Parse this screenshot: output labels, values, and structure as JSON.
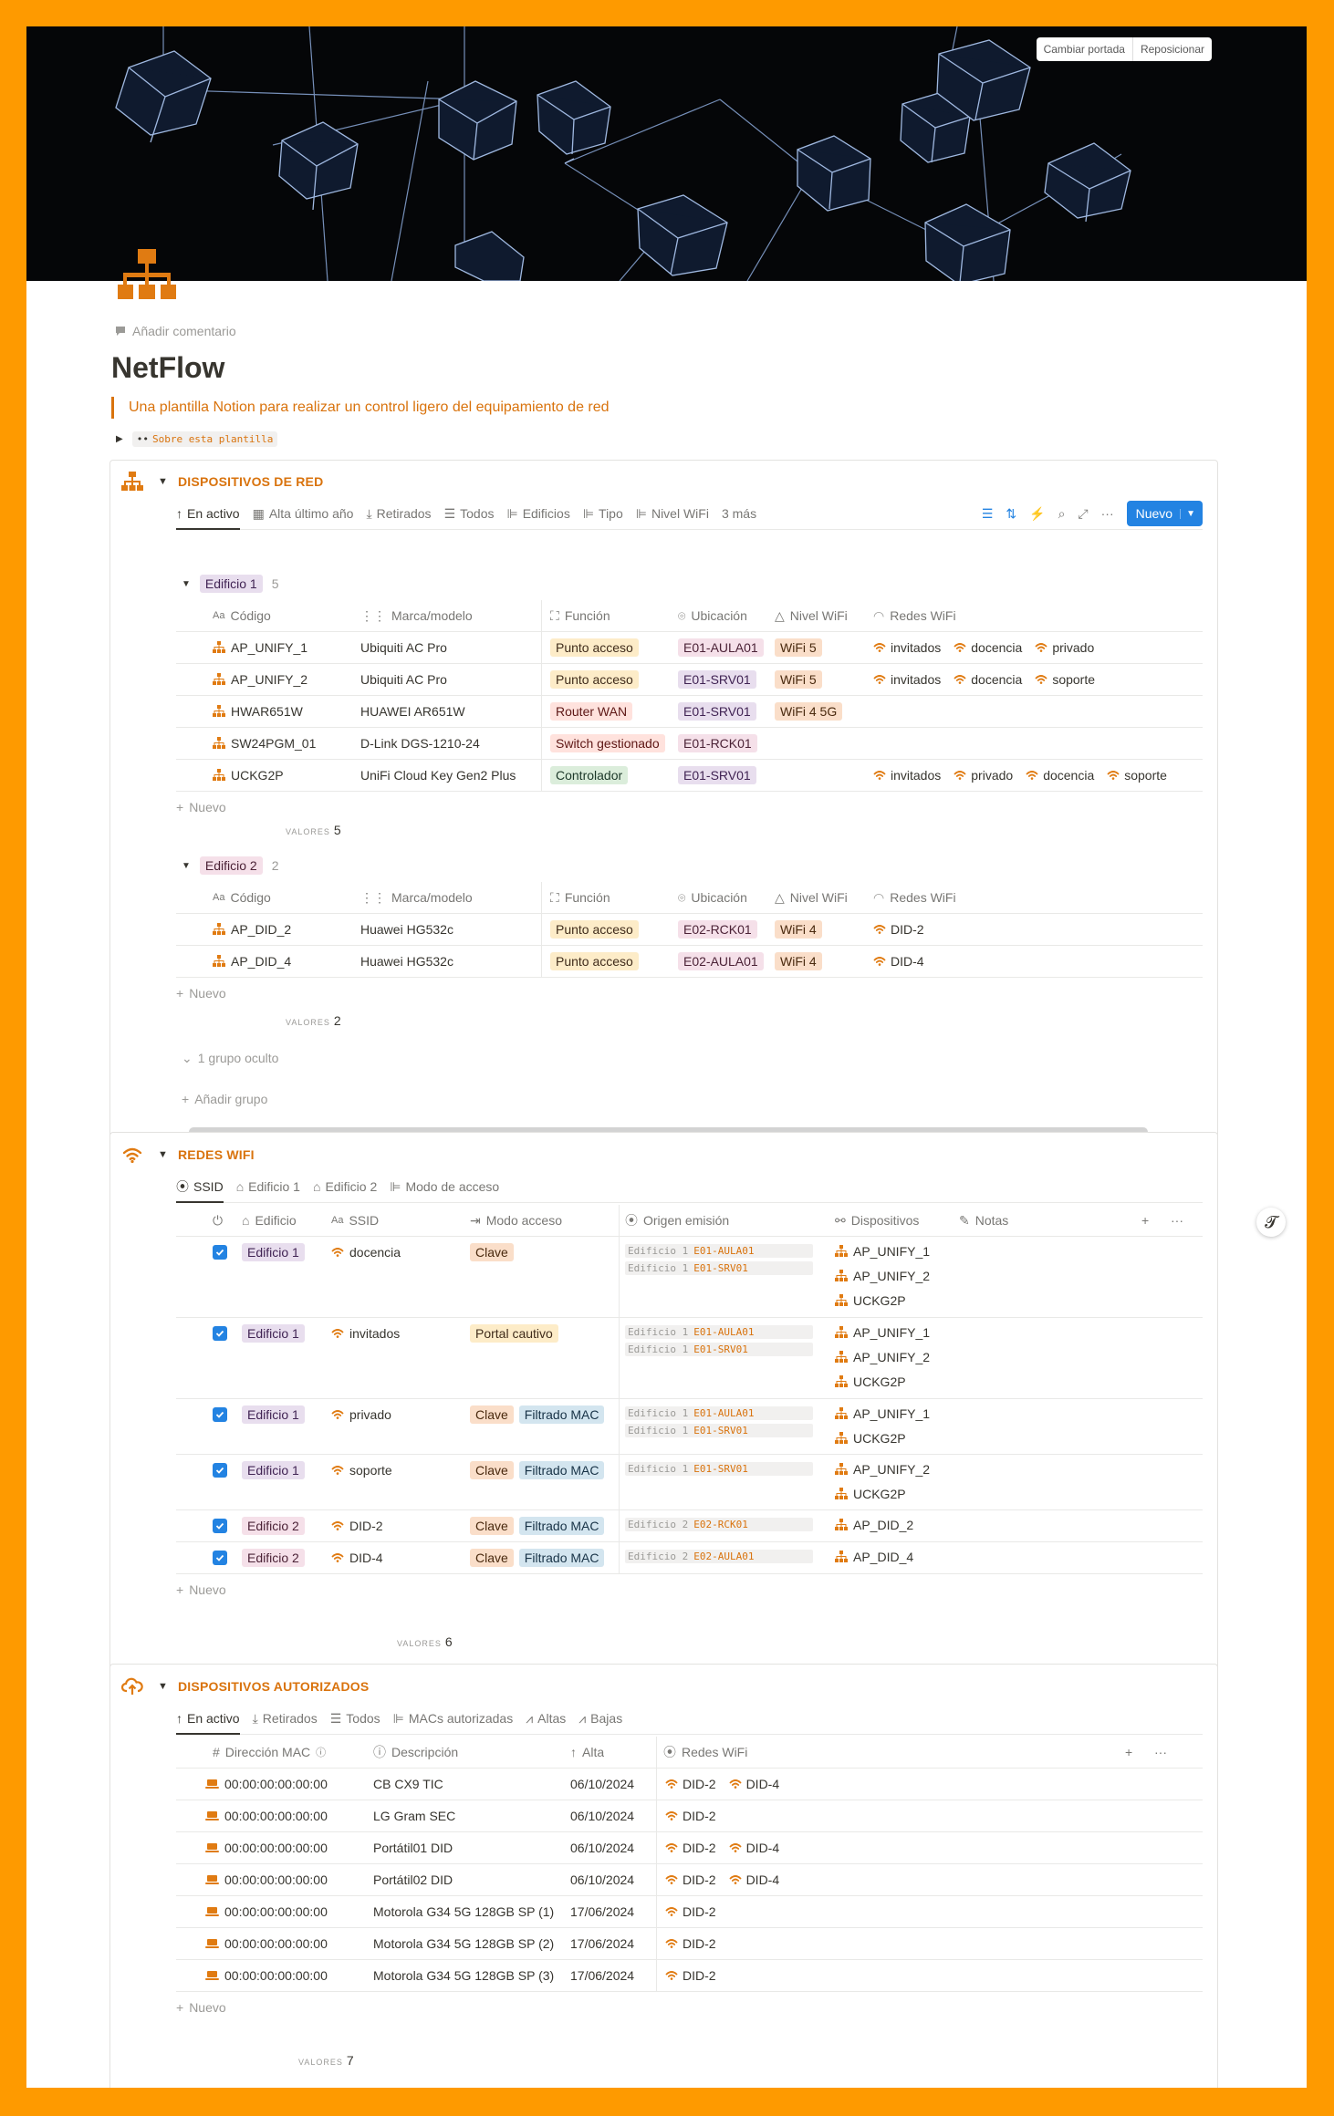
{
  "cover": {
    "change_label": "Cambiar portada",
    "reposition_label": "Reposicionar"
  },
  "page": {
    "icon": "network-hierarchy-icon",
    "add_comment": "Añadir comentario",
    "title": "NetFlow",
    "quote": "Una plantilla Notion para realizar un control ligero del equipamiento de red",
    "toggle_label": "Sobre esta plantilla",
    "toggle_prefix": "••"
  },
  "colors": {
    "accent": "#d9730d",
    "blue": "#2383e2",
    "background": "#fe9a00"
  },
  "devices": {
    "title": "DISPOSITIVOS DE RED",
    "views": [
      {
        "label": "En activo",
        "icon": "arrow-up-icon"
      },
      {
        "label": "Alta último año",
        "icon": "calendar-icon"
      },
      {
        "label": "Retirados",
        "icon": "download-icon"
      },
      {
        "label": "Todos",
        "icon": "list-icon"
      },
      {
        "label": "Edificios",
        "icon": "board-icon"
      },
      {
        "label": "Tipo",
        "icon": "board-icon"
      },
      {
        "label": "Nivel WiFi",
        "icon": "board-icon"
      }
    ],
    "more_views": "3 más",
    "new_button": "Nuevo",
    "columns": [
      "Código",
      "Marca/modelo",
      "Función",
      "Ubicación",
      "Nivel WiFi",
      "Redes WiFi"
    ],
    "groups": [
      {
        "name": "Edificio 1",
        "count": "5",
        "rows": [
          {
            "code": "AP_UNIFY_1",
            "model": "Ubiquiti AC Pro",
            "function": "Punto acceso",
            "location": "E01-AULA01",
            "wifi_level": "WiFi 5",
            "networks": [
              "invitados",
              "docencia",
              "privado"
            ]
          },
          {
            "code": "AP_UNIFY_2",
            "model": "Ubiquiti AC Pro",
            "function": "Punto acceso",
            "location": "E01-SRV01",
            "wifi_level": "WiFi 5",
            "networks": [
              "invitados",
              "docencia",
              "soporte"
            ]
          },
          {
            "code": "HWAR651W",
            "model": "HUAWEI AR651W",
            "function": "Router WAN",
            "location": "E01-SRV01",
            "wifi_level": "WiFi 4 5G",
            "networks": []
          },
          {
            "code": "SW24PGM_01",
            "model": "D-Link DGS-1210-24",
            "function": "Switch gestionado",
            "location": "E01-RCK01",
            "wifi_level": "",
            "networks": []
          },
          {
            "code": "UCKG2P",
            "model": "UniFi Cloud Key Gen2 Plus",
            "function": "Controlador",
            "location": "E01-SRV01",
            "wifi_level": "",
            "networks": [
              "invitados",
              "privado",
              "docencia",
              "soporte"
            ]
          }
        ],
        "values_label": "VALORES",
        "values_count": "5"
      },
      {
        "name": "Edificio 2",
        "count": "2",
        "rows": [
          {
            "code": "AP_DID_2",
            "model": "Huawei HG532c",
            "function": "Punto acceso",
            "location": "E02-RCK01",
            "wifi_level": "WiFi 4",
            "networks": [
              "DID-2"
            ]
          },
          {
            "code": "AP_DID_4",
            "model": "Huawei HG532c",
            "function": "Punto acceso",
            "location": "E02-AULA01",
            "wifi_level": "WiFi 4",
            "networks": [
              "DID-4"
            ]
          }
        ],
        "values_label": "VALORES",
        "values_count": "2"
      }
    ],
    "new_row": "Nuevo",
    "hidden_group": "1 grupo oculto",
    "add_group": "Añadir grupo"
  },
  "wifi": {
    "title": "REDES WIFI",
    "views": [
      {
        "label": "SSID",
        "icon": "broadcast-icon"
      },
      {
        "label": "Edificio 1",
        "icon": "building-icon"
      },
      {
        "label": "Edificio 2",
        "icon": "building-icon"
      },
      {
        "label": "Modo de acceso",
        "icon": "board-icon"
      }
    ],
    "columns": [
      "Edificio",
      "SSID",
      "Modo acceso",
      "Origen emisión",
      "Dispositivos",
      "Notas"
    ],
    "rows": [
      {
        "checked": true,
        "building": "Edificio 1",
        "ssid": "docencia",
        "modes": [
          "Clave"
        ],
        "origins": [
          [
            "Edificio 1",
            "E01-AULA01"
          ],
          [
            "Edificio 1",
            "E01-SRV01"
          ]
        ],
        "devices": [
          "AP_UNIFY_1",
          "AP_UNIFY_2",
          "UCKG2P"
        ]
      },
      {
        "checked": true,
        "building": "Edificio 1",
        "ssid": "invitados",
        "modes": [
          "Portal cautivo"
        ],
        "origins": [
          [
            "Edificio 1",
            "E01-AULA01"
          ],
          [
            "Edificio 1",
            "E01-SRV01"
          ]
        ],
        "devices": [
          "AP_UNIFY_1",
          "AP_UNIFY_2",
          "UCKG2P"
        ]
      },
      {
        "checked": true,
        "building": "Edificio 1",
        "ssid": "privado",
        "modes": [
          "Clave",
          "Filtrado MAC"
        ],
        "origins": [
          [
            "Edificio 1",
            "E01-AULA01"
          ],
          [
            "Edificio 1",
            "E01-SRV01"
          ]
        ],
        "devices": [
          "AP_UNIFY_1",
          "UCKG2P"
        ]
      },
      {
        "checked": true,
        "building": "Edificio 1",
        "ssid": "soporte",
        "modes": [
          "Clave",
          "Filtrado MAC"
        ],
        "origins": [
          [
            "Edificio 1",
            "E01-SRV01"
          ]
        ],
        "devices": [
          "AP_UNIFY_2",
          "UCKG2P"
        ]
      },
      {
        "checked": true,
        "building": "Edificio 2",
        "ssid": "DID-2",
        "modes": [
          "Clave",
          "Filtrado MAC"
        ],
        "origins": [
          [
            "Edificio 2",
            "E02-RCK01"
          ]
        ],
        "devices": [
          "AP_DID_2"
        ]
      },
      {
        "checked": true,
        "building": "Edificio 2",
        "ssid": "DID-4",
        "modes": [
          "Clave",
          "Filtrado MAC"
        ],
        "origins": [
          [
            "Edificio 2",
            "E02-AULA01"
          ]
        ],
        "devices": [
          "AP_DID_4"
        ]
      }
    ],
    "new_row": "Nuevo",
    "values_label": "VALORES",
    "values_count": "6"
  },
  "authorized": {
    "title": "DISPOSITIVOS AUTORIZADOS",
    "views": [
      {
        "label": "En activo",
        "icon": "arrow-up-icon"
      },
      {
        "label": "Retirados",
        "icon": "download-icon"
      },
      {
        "label": "Todos",
        "icon": "list-icon"
      },
      {
        "label": "MACs autorizadas",
        "icon": "board-icon"
      },
      {
        "label": "Altas",
        "icon": "chart-icon"
      },
      {
        "label": "Bajas",
        "icon": "chart-icon"
      }
    ],
    "columns": [
      "Dirección MAC",
      "Descripción",
      "Alta",
      "Redes WiFi"
    ],
    "rows": [
      {
        "mac": "00:00:00:00:00:00",
        "description": "CB CX9 TIC",
        "date": "06/10/2024",
        "networks": [
          "DID-2",
          "DID-4"
        ]
      },
      {
        "mac": "00:00:00:00:00:00",
        "description": "LG Gram SEC",
        "date": "06/10/2024",
        "networks": [
          "DID-2"
        ]
      },
      {
        "mac": "00:00:00:00:00:00",
        "description": "Portátil01 DID",
        "date": "06/10/2024",
        "networks": [
          "DID-2",
          "DID-4"
        ]
      },
      {
        "mac": "00:00:00:00:00:00",
        "description": "Portátil02 DID",
        "date": "06/10/2024",
        "networks": [
          "DID-2",
          "DID-4"
        ]
      },
      {
        "mac": "00:00:00:00:00:00",
        "description": "Motorola G34 5G 128GB  SP (1)",
        "date": "17/06/2024",
        "networks": [
          "DID-2"
        ]
      },
      {
        "mac": "00:00:00:00:00:00",
        "description": "Motorola G34 5G 128GB  SP (2)",
        "date": "17/06/2024",
        "networks": [
          "DID-2"
        ]
      },
      {
        "mac": "00:00:00:00:00:00",
        "description": "Motorola G34 5G 128GB  SP (3)",
        "date": "17/06/2024",
        "networks": [
          "DID-2"
        ]
      }
    ],
    "new_row": "Nuevo",
    "values_label": "VALORES",
    "values_count": "7"
  },
  "fab_label": "𝓣"
}
